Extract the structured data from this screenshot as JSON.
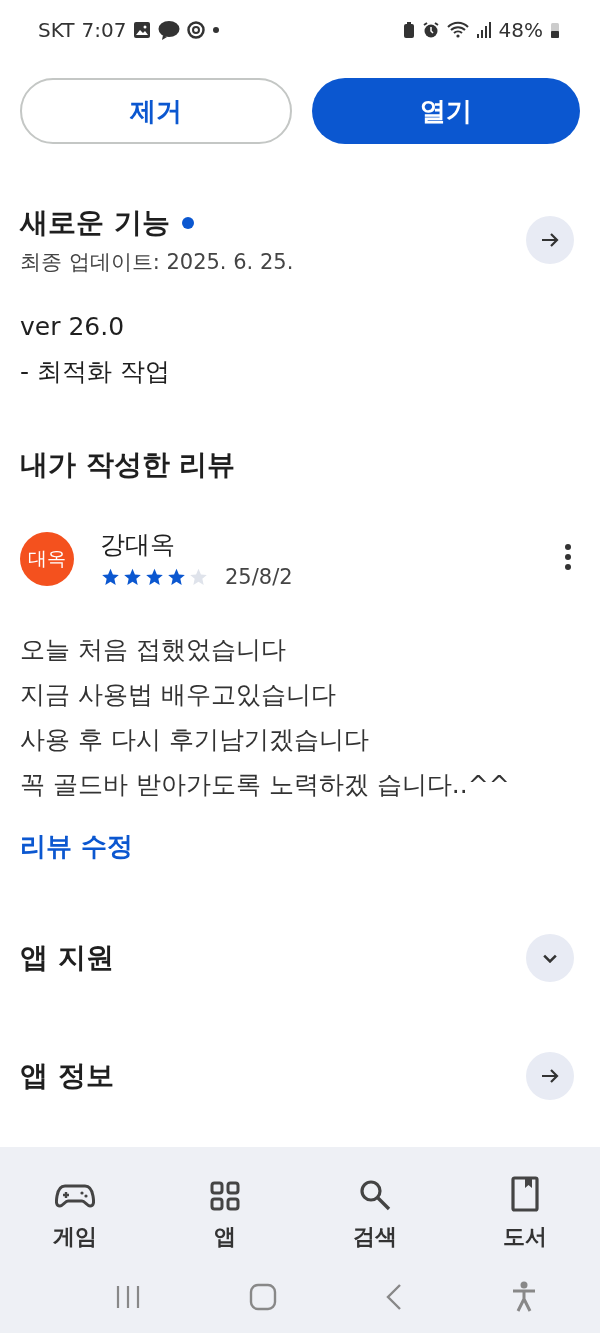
{
  "status_bar": {
    "carrier": "SKT",
    "time": "7:07",
    "battery": "48%"
  },
  "actions": [
    {
      "label": "제거",
      "kind": "outline"
    },
    {
      "label": "열기",
      "kind": "filled"
    }
  ],
  "whats_new": {
    "title": "새로운 기능",
    "unread": true,
    "updated": "최종 업데이트: 2025. 6. 25.",
    "notes": [
      "ver 26.0",
      "- 최적화 작업"
    ]
  },
  "my_review": {
    "title": "내가 작성한 리뷰",
    "avatar_text": "대옥",
    "author": "강대옥",
    "stars": 4,
    "date": "25/8/2",
    "lines": [
      "오늘 처음 접했었습니다",
      "지금 사용법 배우고있습니다",
      "사용 후 다시 후기남기겠습니다",
      "꼭 골드바 받아가도록 노력하겠 습니다..^^"
    ],
    "edit_link": "리뷰 수정"
  },
  "sections": [
    {
      "title": "앱 지원",
      "kind": "expand"
    },
    {
      "title": "앱 정보",
      "kind": "arrow"
    }
  ],
  "bottom_nav": [
    {
      "label": "게임",
      "kind": "games"
    },
    {
      "label": "앱",
      "kind": "apps"
    },
    {
      "label": "검색",
      "kind": "search"
    },
    {
      "label": "도서",
      "kind": "books"
    }
  ]
}
